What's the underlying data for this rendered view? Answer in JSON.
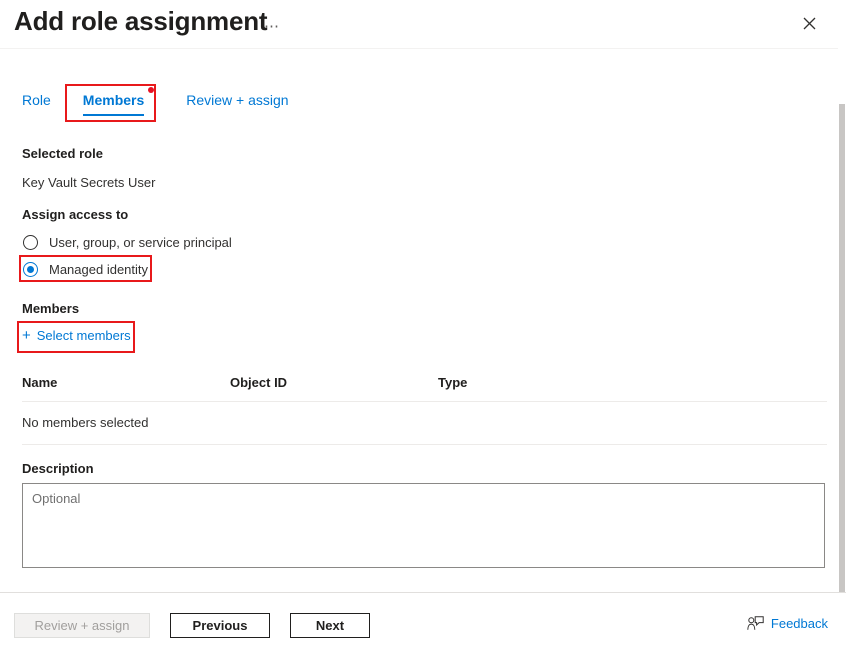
{
  "header": {
    "title": "Add role assignment",
    "ellipsis_label": "⋯",
    "close_icon": "close-icon"
  },
  "tabs": [
    {
      "label": "Role",
      "active": false
    },
    {
      "label": "Members",
      "active": true,
      "has_dot": true
    },
    {
      "label": "Review + assign",
      "active": false
    }
  ],
  "form": {
    "selected_role_label": "Selected role",
    "selected_role_value": "Key Vault Secrets User",
    "assign_access_label": "Assign access to",
    "radio_options": [
      {
        "label": "User, group, or service principal",
        "checked": false
      },
      {
        "label": "Managed identity",
        "checked": true
      }
    ],
    "members_label": "Members",
    "select_members_link": "Select members",
    "plus_icon": "+",
    "description_label": "Description",
    "description_value": "",
    "description_placeholder": "Optional"
  },
  "members_table": {
    "columns": [
      "Name",
      "Object ID",
      "Type"
    ],
    "empty_message": "No members selected"
  },
  "footer": {
    "review_assign_label": "Review + assign",
    "previous_label": "Previous",
    "next_label": "Next",
    "feedback_label": "Feedback",
    "feedback_icon": "feedback-icon"
  },
  "colors": {
    "accent": "#0078d4",
    "annotation": "#e8191b",
    "dot": "#e81123",
    "disabled_text": "#a19f9d"
  }
}
